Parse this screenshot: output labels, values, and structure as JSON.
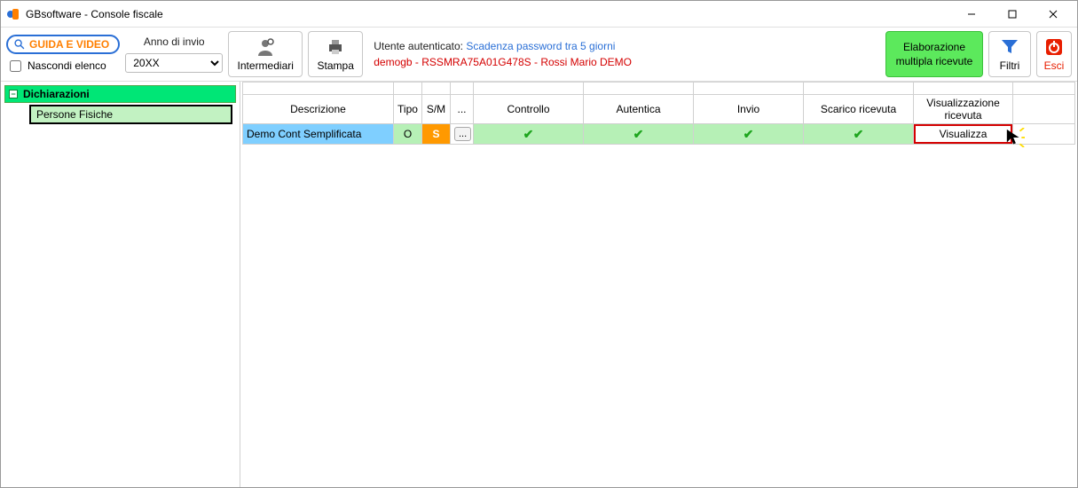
{
  "window": {
    "title": "GBsoftware - Console fiscale"
  },
  "toolbar": {
    "guida_label": "GUIDA E VIDEO",
    "hide_list_label": "Nascondi elenco",
    "year_label": "Anno di invio",
    "year_value": "20XX",
    "intermediari_label": "Intermediari",
    "stampa_label": "Stampa",
    "auth_label": "Utente autenticato:",
    "auth_status": "Scadenza password tra 5 giorni",
    "auth_detail": "demogb - RSSMRA75A01G478S - Rossi Mario DEMO",
    "elab_line1": "Elaborazione",
    "elab_line2": "multipla ricevute",
    "filtri_label": "Filtri",
    "esci_label": "Esci"
  },
  "tree": {
    "root_label": "Dichiarazioni",
    "child1_label": "Persone Fisiche"
  },
  "table": {
    "headers": {
      "descrizione": "Descrizione",
      "tipo": "Tipo",
      "sm": "S/M",
      "more": "...",
      "controllo": "Controllo",
      "autentica": "Autentica",
      "invio": "Invio",
      "scarico": "Scarico ricevuta",
      "visualizzazione_l1": "Visualizzazione",
      "visualizzazione_l2": "ricevuta"
    },
    "row": {
      "descrizione": "Demo Cont Semplificata",
      "tipo": "O",
      "sm": "S",
      "more": "...",
      "controllo_ok": true,
      "autentica_ok": true,
      "invio_ok": true,
      "scarico_ok": true,
      "visualizza_label": "Visualizza"
    }
  }
}
